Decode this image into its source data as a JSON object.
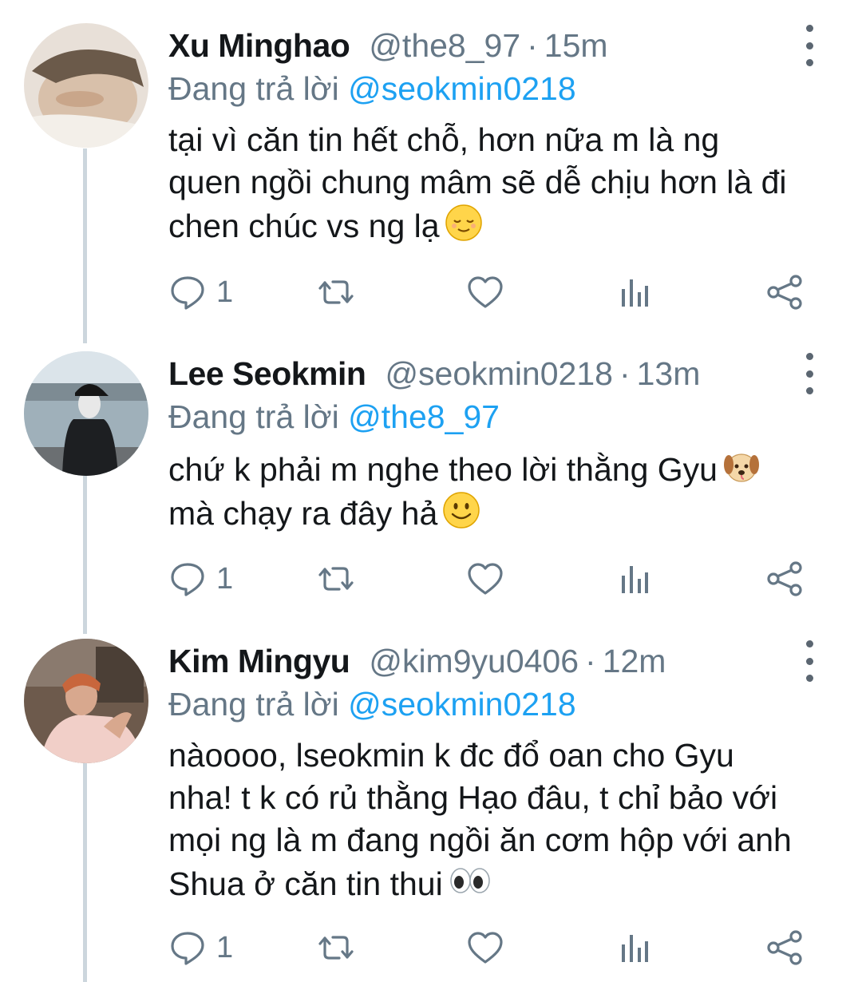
{
  "tweets": [
    {
      "name": "Xu Minghao",
      "handle": "@the8_97",
      "time": "15m",
      "reply_prefix": "Đang trả lời",
      "reply_to": "@seokmin0218",
      "body_lines": [
        "tại vì căn tin hết chỗ, hơn nữa m là ng",
        "quen ngồi chung mâm sẽ dễ chịu hơn là đi",
        "chen chúc vs ng lạ"
      ],
      "emoji": "relieved-face-icon",
      "reply_count": "1"
    },
    {
      "name": "Lee Seokmin",
      "handle": "@seokmin0218",
      "time": "13m",
      "reply_prefix": "Đang trả lời",
      "reply_to": "@the8_97",
      "body_lines": [
        "chứ k phải m nghe theo lời thằng Gyu",
        "mà chạy ra đây hả"
      ],
      "emoji": "dog-face-icon",
      "reply_count": "1"
    },
    {
      "name": "Kim Mingyu",
      "handle": "@kim9yu0406",
      "time": "12m",
      "reply_prefix": "Đang trả lời",
      "reply_to": "@seokmin0218",
      "body_lines": [
        "nàoooo, lseokmin k đc đổ oan cho Gyu",
        "nha! t k có rủ thằng Hạo đâu, t chỉ bảo với",
        "mọi ng là m đang ngồi ăn cơm hộp với anh",
        "Shua ở căn tin thui"
      ],
      "emoji": "eyes-icon",
      "reply_count": "1"
    }
  ],
  "dot_separator": "·",
  "colors": {
    "link": "#1da1f2",
    "secondary": "#657786",
    "text": "#14171a",
    "thread_line": "#ccd6dd"
  }
}
